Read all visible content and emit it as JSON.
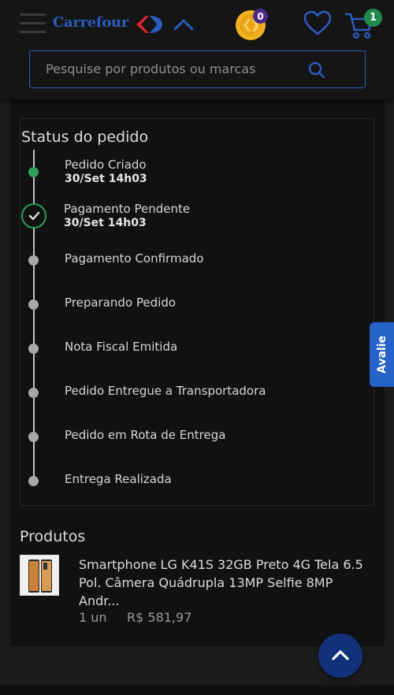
{
  "header": {
    "brand": "Carrefour",
    "coin_badge": "0",
    "cart_badge": "1",
    "search_placeholder": "Pesquise por produtos ou marcas",
    "icons": [
      "menu-icon",
      "carrefour-logo",
      "chevron-up-icon",
      "coin-icon",
      "heart-icon",
      "cart-icon",
      "search-icon"
    ],
    "colors": {
      "brand_blue": "#2b5bbd",
      "badge_green": "#1f8a4c",
      "badge_purple": "#4b2a8c",
      "coin_gold": "#f2b320"
    }
  },
  "status": {
    "title": "Status do pedido",
    "steps": [
      {
        "label": "Pedido Criado",
        "date": "30/Set 14h03",
        "state": "done"
      },
      {
        "label": "Pagamento Pendente",
        "date": "30/Set 14h03",
        "state": "current"
      },
      {
        "label": "Pagamento Confirmado",
        "state": "pending"
      },
      {
        "label": "Preparando Pedido",
        "state": "pending"
      },
      {
        "label": "Nota Fiscal Emitida",
        "state": "pending"
      },
      {
        "label": "Pedido Entregue a Transportadora",
        "state": "pending"
      },
      {
        "label": "Pedido em Rota de Entrega",
        "state": "pending"
      },
      {
        "label": "Entrega Realizada",
        "state": "pending"
      }
    ],
    "colors": {
      "done": "#2f9e58",
      "pending": "#a8a8a8"
    }
  },
  "products": {
    "title": "Produtos",
    "items": [
      {
        "name": "Smartphone LG K41S 32GB Preto 4G Tela 6.5 Pol. Câmera Quádrupla 13MP Selfie 8MP Andr...",
        "qty": "1 un",
        "price": "R$ 581,97"
      }
    ]
  },
  "floating": {
    "avalie": "Avalie",
    "scroll_top_icon": "chevron-up-icon",
    "colors": {
      "avalie": "#2563c8",
      "scroll_top": "#13317a"
    }
  }
}
